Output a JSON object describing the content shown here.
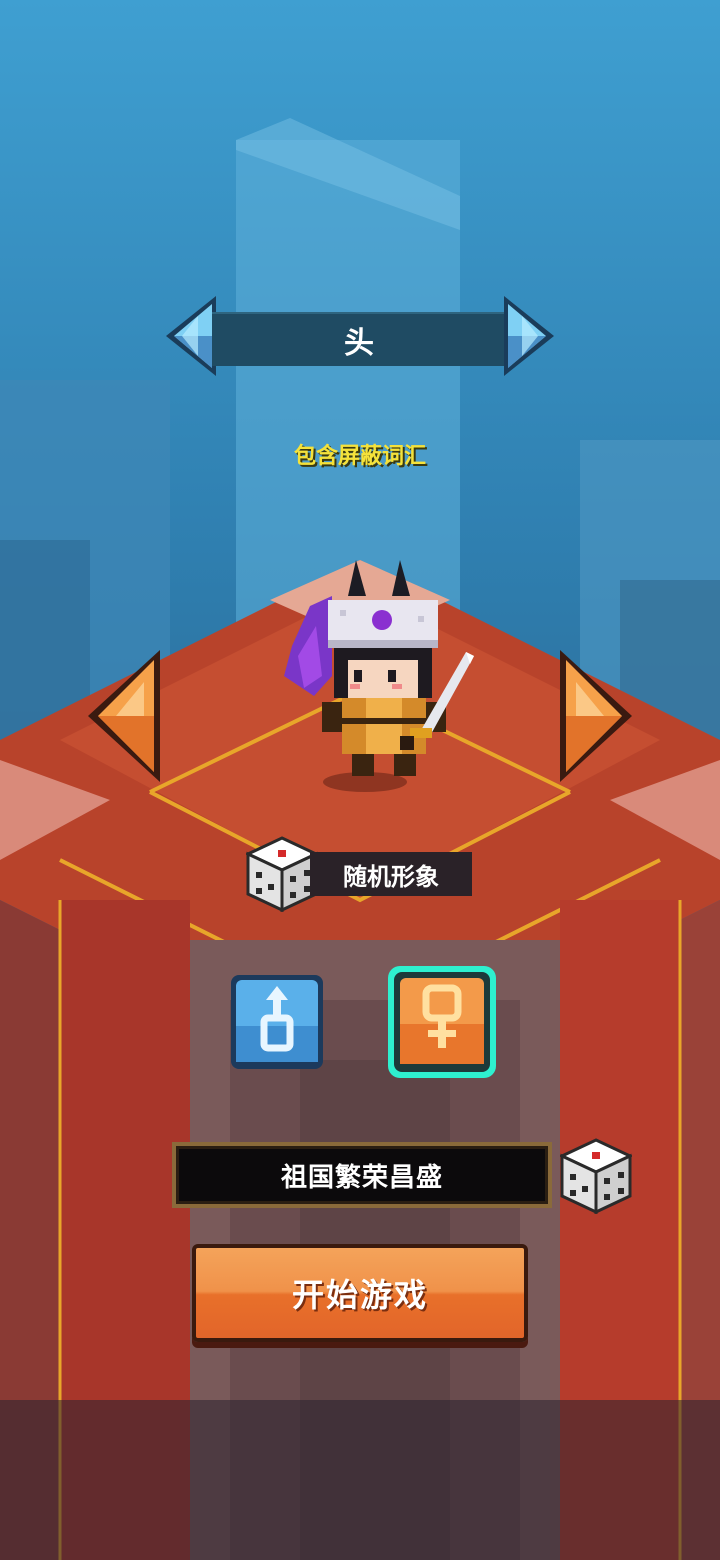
{
  "category_selector": {
    "label": "头"
  },
  "warning": {
    "text": "包含屏蔽词汇"
  },
  "random_look": {
    "label": "随机形象"
  },
  "gender": {
    "male_symbol": "♂",
    "female_symbol": "♀",
    "selected": "female"
  },
  "name_field": {
    "value": "祖国繁荣昌盛"
  },
  "start_button": {
    "label": "开始游戏"
  },
  "icons": {
    "prev_category": "chevron-left-icon",
    "next_category": "chevron-right-icon",
    "prev_look": "arrow-left-icon",
    "next_look": "arrow-right-icon",
    "random_look_dice": "dice-icon",
    "random_name_dice": "dice-icon"
  },
  "colors": {
    "sky": "#3f9fd1",
    "platform_red": "#b8432b",
    "accent_orange": "#f0924a",
    "accent_blue": "#4aa6e8",
    "selected_glow": "#3ff0d0",
    "warning_yellow": "#f5e23a"
  }
}
